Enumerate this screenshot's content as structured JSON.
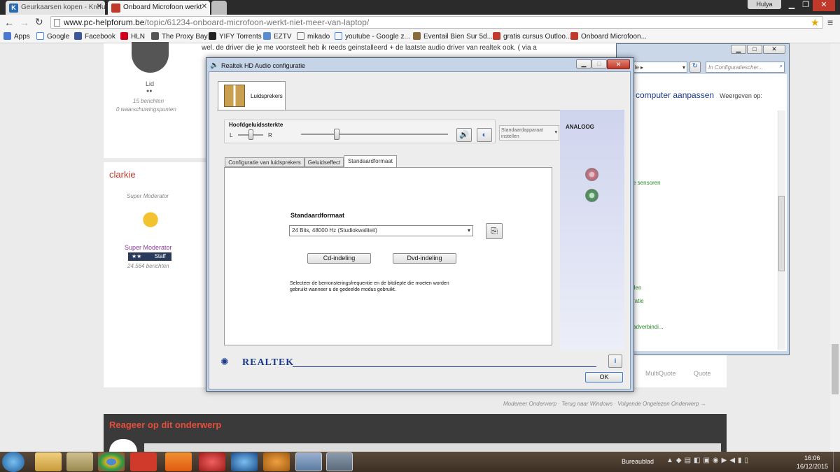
{
  "browser": {
    "tabs": [
      {
        "label": "Geurkaarsen kopen - Kréfu",
        "icon": "K"
      },
      {
        "label": "Onboard Microfoon werkt"
      }
    ],
    "user": "Hulya",
    "url_host": "www.pc-helpforum.be",
    "url_path": "/topic/61234-onboard-microfoon-werkt-niet-meer-van-laptop/",
    "bookmarks": [
      "Apps",
      "Google",
      "Facebook",
      "HLN",
      "The Proxy Bay",
      "YIFY Torrents",
      "EZTV",
      "mikado",
      "youtube - Google z...",
      "Eventail Bien Sur 5d...",
      "gratis cursus Outloo...",
      "Onboard Microfoon..."
    ]
  },
  "forum": {
    "post_text": "wel. de driver die je me voorsteelt heb ik reeds geinstalleerd + de laatste audio driver van realtek ook. ( via a",
    "user1": {
      "role": "Lid",
      "pips": "●●",
      "posts": "15 berichten",
      "warnings": "0 waarschuwingspunten"
    },
    "user2": {
      "name": "clarkie",
      "title": "Super Moderator",
      "group": "Super Moderator",
      "stars": "★★",
      "staff": "Staff",
      "posts": "24.564 berichten"
    },
    "multiquote": "MultiQuote",
    "quote": "Quote",
    "nav": "Modereer Onderwerp · Terug naar Windows · Volgende Ongelezen Onderwerp →",
    "reply_title": "Reageer op dit onderwerp"
  },
  "control_panel": {
    "address_tail": "ille ▸",
    "search_placeholder": "In Configuratiescher...",
    "heading": "computer aanpassen",
    "view": "Weergeven op:",
    "links": [
      "e sensoren",
      "llen",
      "ratie",
      "adverbindi..."
    ]
  },
  "realtek": {
    "title": "Realtek HD Audio configuratie",
    "speaker_tab": "Luidsprekers",
    "master_volume": "Hoofdgeluidssterkte",
    "left": "L",
    "right": "R",
    "default_device": "Standaardapparaat instellen",
    "analog": "ANALOOG",
    "tabs": [
      "Configuratie van luidsprekers",
      "Geluidseffect",
      "Standaardformaat"
    ],
    "format_heading": "Standaardformaat",
    "format_value": "24 Bits, 48000 Hz (Studiokwaliteit)",
    "cd_button": "Cd-indeling",
    "dvd_button": "Dvd-indeling",
    "description": "Selecteer de bemonsteringsfrequentie en de bitdiepte die moeten worden gebruikt wanneer u de gedeelde modus gebruikt.",
    "brand": "REALTEK",
    "ok": "OK"
  },
  "taskbar": {
    "desktop": "Bureaublad",
    "time": "16:06",
    "date": "16/12/2015"
  },
  "colors": {
    "accent_red": "#c0392b",
    "forum_dark": "#3a3a3a",
    "green_jack": "#5a9a6a",
    "pink_jack": "#c87a8a"
  }
}
